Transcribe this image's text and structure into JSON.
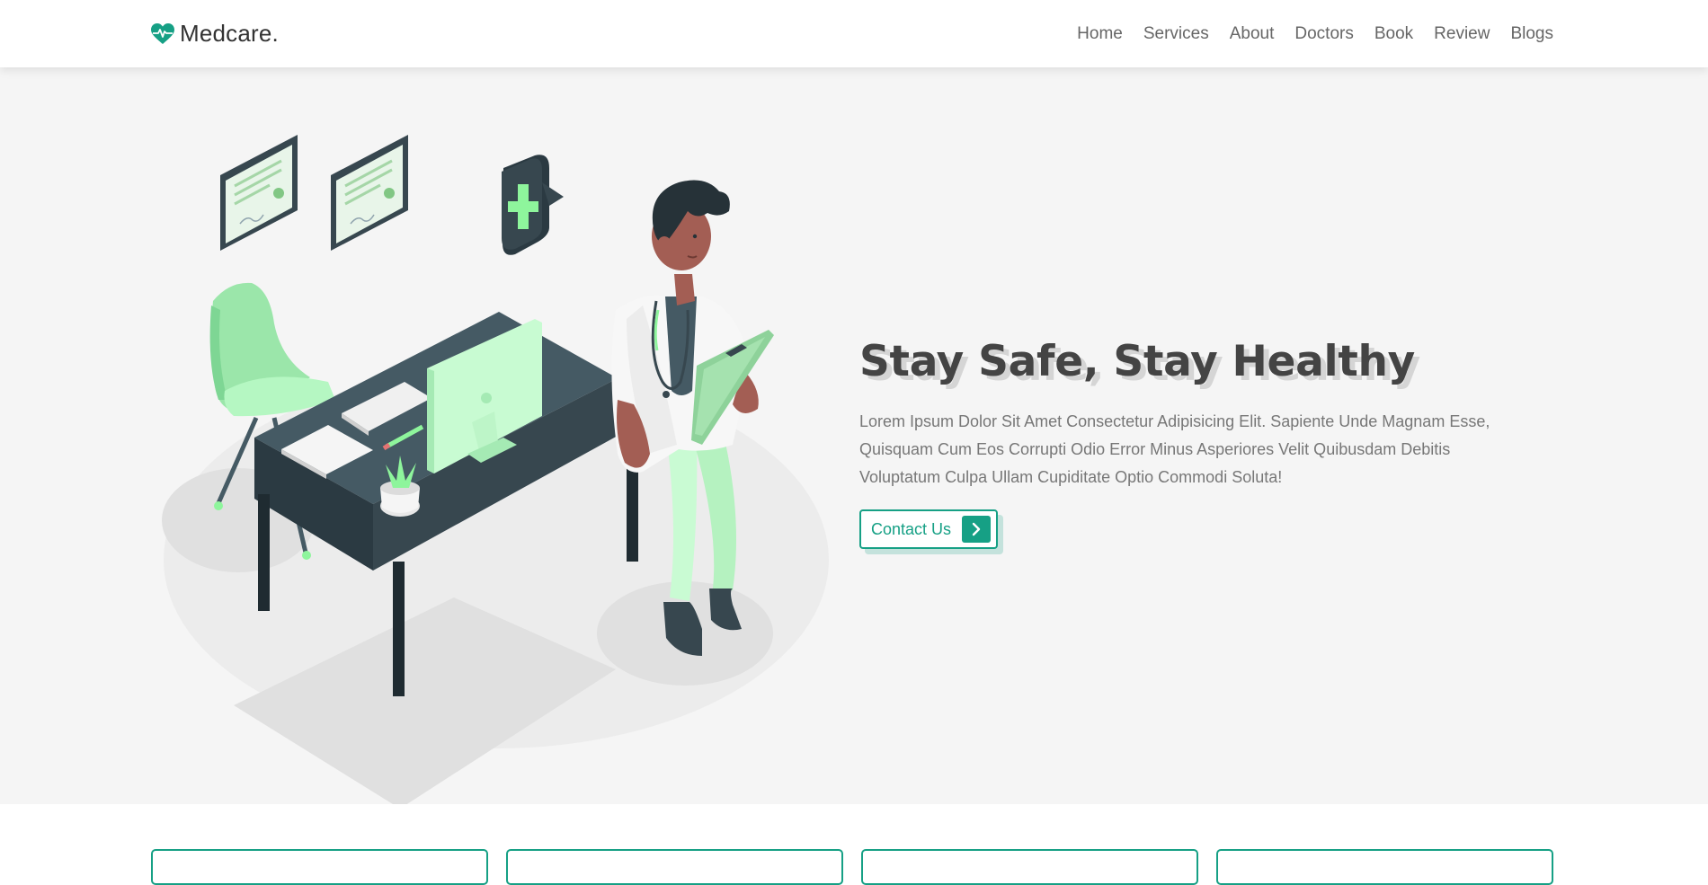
{
  "header": {
    "logo_text": "Medcare.",
    "logo_icon": "heartbeat-icon",
    "nav": [
      "Home",
      "Services",
      "About",
      "Doctors",
      "Book",
      "Review",
      "Blogs"
    ]
  },
  "hero": {
    "title": "Stay Safe, Stay Healthy",
    "text": "Lorem Ipsum Dolor Sit Amet Consectetur Adipisicing Elit. Sapiente Unde Magnam Esse, Quisquam Cum Eos Corrupti Odio Error Minus Asperiores Velit Quibusdam Debitis Voluptatum Culpa Ullam Cupiditate Optio Commodi Soluta!",
    "button_label": "Contact Us",
    "button_icon": "chevron-right-icon"
  },
  "colors": {
    "accent": "#16a085",
    "heading": "#444444",
    "body_text": "#777777",
    "hero_bg": "#f5f5f5"
  }
}
